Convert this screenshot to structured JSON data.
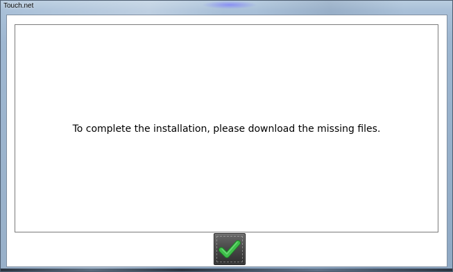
{
  "window": {
    "title": "Touch.net"
  },
  "dialog": {
    "message": "To complete the installation, please download the missing files."
  },
  "ok_button": {
    "icon": "checkmark-icon",
    "icon_color": "#3fbf4a"
  },
  "colors": {
    "frame": "#9fb6cf",
    "panel_background": "#ffffff",
    "button_background": "#4a4a4a"
  }
}
